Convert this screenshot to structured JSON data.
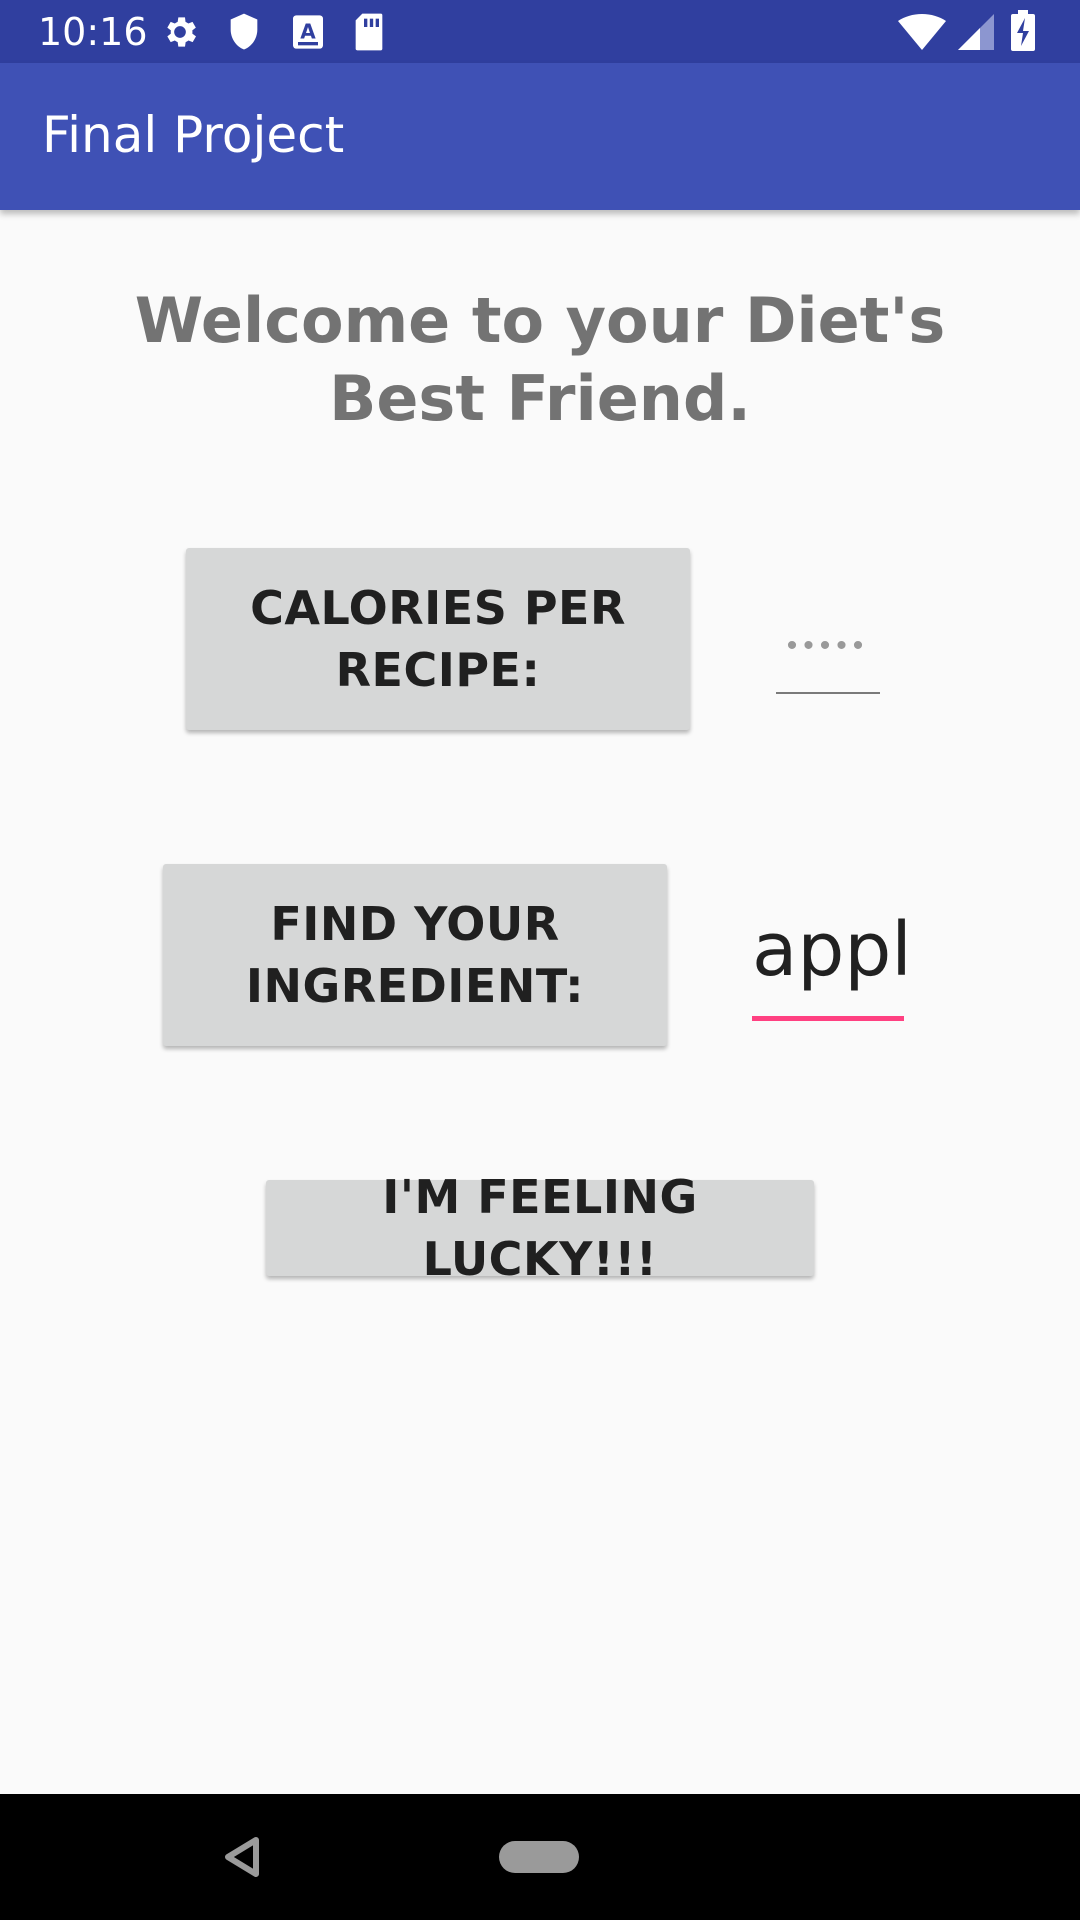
{
  "status_bar": {
    "time": "10:16",
    "icons": [
      "settings-icon",
      "shield-icon",
      "a-text-icon",
      "sd-card-icon",
      "wifi-icon",
      "signal-icon",
      "battery-charging-icon"
    ]
  },
  "app_bar": {
    "title": "Final Project"
  },
  "main": {
    "welcome": "Welcome to your Diet's Best Friend.",
    "calories_button": "CALORIES PER RECIPE:",
    "calories_field_placeholder": "•••••",
    "ingredient_button": "FIND YOUR INGREDIENT:",
    "ingredient_field_value": "appl",
    "lucky_button": "I'M FEELING LUCKY!!!"
  },
  "colors": {
    "status_bar": "#303f9f",
    "app_bar": "#3f51b5",
    "accent": "#ff4081",
    "button": "#d6d7d7",
    "background": "#fafafa"
  },
  "nav_bar": {
    "icons": [
      "back-icon",
      "home-pill-icon"
    ]
  }
}
